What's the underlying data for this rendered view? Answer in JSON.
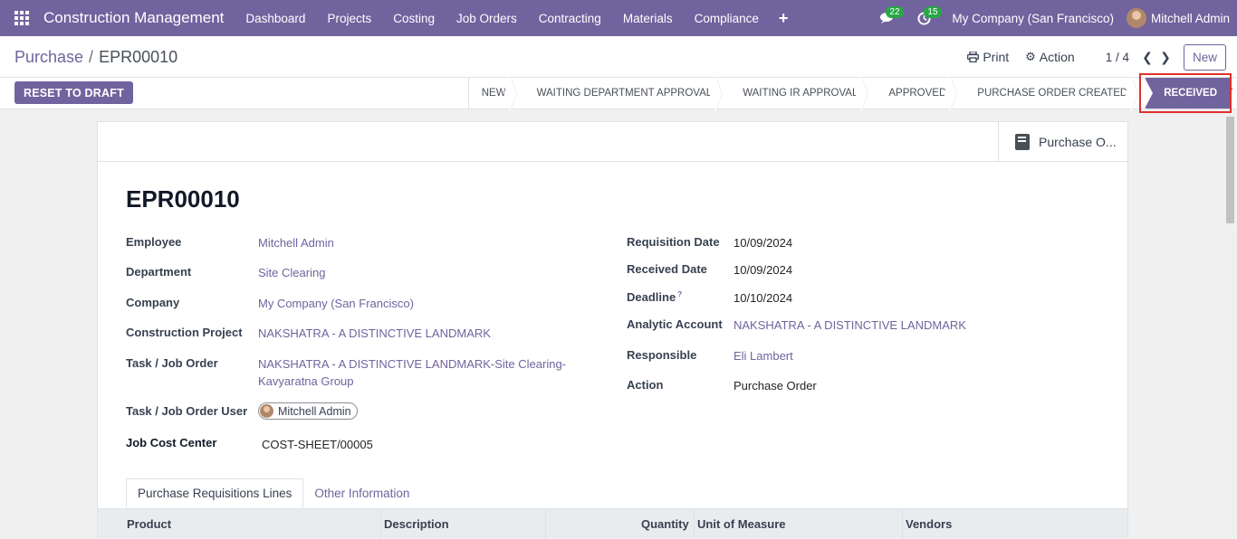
{
  "navbar": {
    "brand": "Construction Management",
    "menu": [
      "Dashboard",
      "Projects",
      "Costing",
      "Job Orders",
      "Contracting",
      "Materials",
      "Compliance"
    ],
    "messages_count": "22",
    "activities_count": "15",
    "company": "My Company (San Francisco)",
    "user": "Mitchell Admin"
  },
  "control": {
    "breadcrumb_parent": "Purchase",
    "breadcrumb_sep": "/",
    "breadcrumb_current": "EPR00010",
    "print_label": "Print",
    "action_label": "Action",
    "pager": "1 / 4",
    "new_label": "New"
  },
  "statusbar": {
    "reset_label": "RESET TO DRAFT",
    "stages": [
      "NEW",
      "WAITING DEPARTMENT APPROVAL",
      "WAITING IR APPROVAL",
      "APPROVED",
      "PURCHASE ORDER CREATED"
    ],
    "active_stage": "RECEIVED"
  },
  "form": {
    "smart_button": "Purchase O...",
    "title": "EPR00010",
    "left": {
      "employee_label": "Employee",
      "employee": "Mitchell Admin",
      "department_label": "Department",
      "department": "Site Clearing",
      "company_label": "Company",
      "company": "My Company (San Francisco)",
      "project_label": "Construction Project",
      "project": "NAKSHATRA - A DISTINCTIVE LANDMARK",
      "task_label": "Task / Job Order",
      "task_line1": "NAKSHATRA - A DISTINCTIVE LANDMARK-Site Clearing-",
      "task_line2": "Kavyaratna Group",
      "task_user_label": "Task / Job Order User",
      "task_user": "Mitchell Admin",
      "cost_center_label": "Job Cost Center",
      "cost_center": "COST-SHEET/00005"
    },
    "right": {
      "req_date_label": "Requisition Date",
      "req_date": "10/09/2024",
      "received_label": "Received Date",
      "received": "10/09/2024",
      "deadline_label": "Deadline",
      "deadline_help": "?",
      "deadline": "10/10/2024",
      "analytic_label": "Analytic Account",
      "analytic": "NAKSHATRA - A DISTINCTIVE LANDMARK",
      "responsible_label": "Responsible",
      "responsible": "Eli Lambert",
      "action_label": "Action",
      "action": "Purchase Order"
    },
    "tabs": [
      "Purchase Requisitions Lines",
      "Other Information"
    ],
    "columns": [
      "Product",
      "Description",
      "Quantity",
      "Unit of Measure",
      "Vendors"
    ]
  }
}
